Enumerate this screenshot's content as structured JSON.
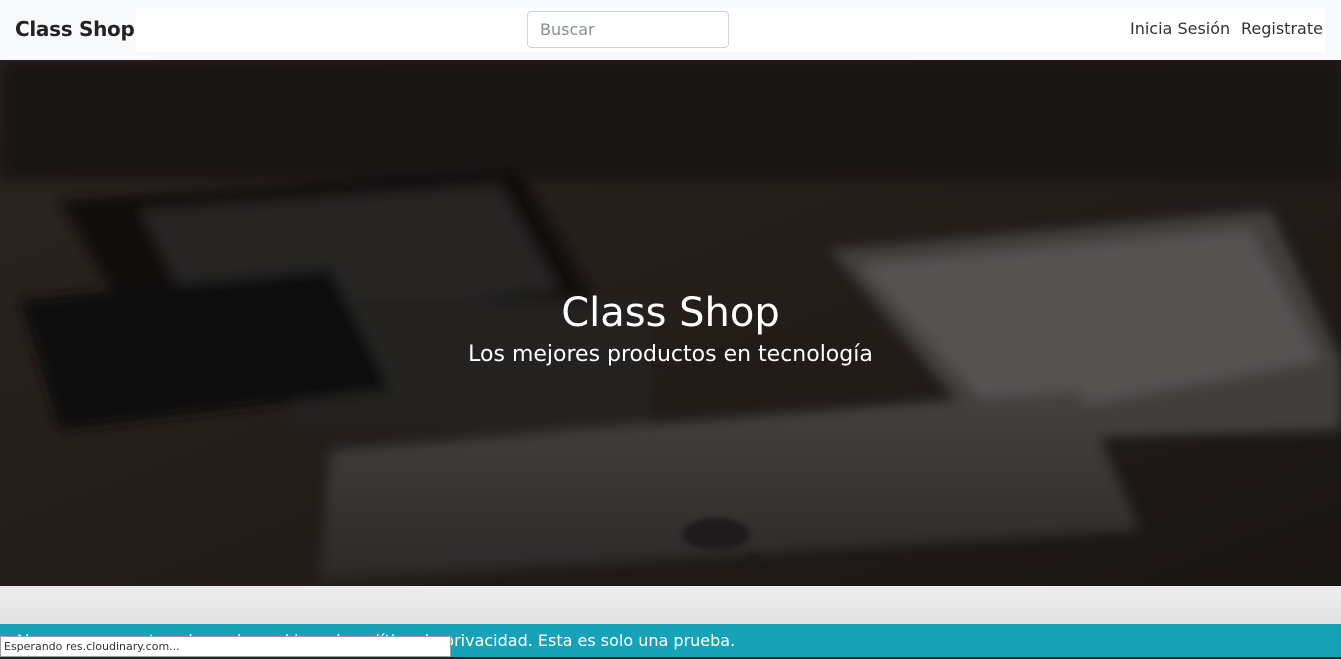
{
  "navbar": {
    "brand": "Class Shop",
    "search": {
      "placeholder": "Buscar",
      "value": ""
    },
    "links": {
      "login": "Inicia Sesión",
      "register": "Registrate"
    }
  },
  "hero": {
    "title": "Class Shop",
    "subtitle": "Los mejores productos en tecnología"
  },
  "notice": {
    "text": "Al navegar, aceptas el uso de cookies y la política de privacidad. Esta es solo una prueba."
  },
  "browser_status": {
    "text": "Esperando res.cloudinary.com..."
  },
  "colors": {
    "navbar_bg": "#f8f9fa",
    "notice_bg": "#17a2b8",
    "hero_text": "#ffffff"
  },
  "icons": {
    "hero_image": "devices-on-desk-photo"
  }
}
